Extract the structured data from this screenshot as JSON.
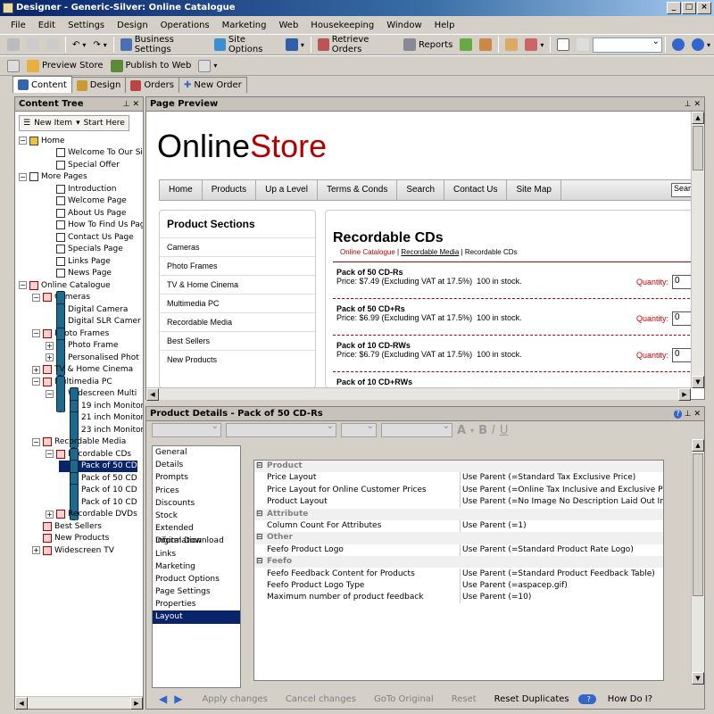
{
  "window": {
    "title": "Designer - Generic-Silver: Online Catalogue"
  },
  "menu": [
    "File",
    "Edit",
    "Settings",
    "Design",
    "Operations",
    "Marketing",
    "Web",
    "Housekeeping",
    "Window",
    "Help"
  ],
  "toolbar1": {
    "business_settings": "Business Settings",
    "site_options": "Site Options",
    "retrieve_orders": "Retrieve Orders",
    "reports": "Reports"
  },
  "toolbar2": {
    "preview_store": "Preview Store",
    "publish_to_web": "Publish to Web"
  },
  "tabs": [
    "Content",
    "Design",
    "Orders",
    "New Order"
  ],
  "content_tree": {
    "title": "Content Tree",
    "new_item": "New Item",
    "start_here": "Start Here",
    "nodes": [
      {
        "label": "Home"
      },
      {
        "label": "Welcome To Our Site"
      },
      {
        "label": "Special Offer"
      },
      {
        "label": "More Pages"
      },
      {
        "label": "Introduction"
      },
      {
        "label": "Welcome Page"
      },
      {
        "label": "About Us Page"
      },
      {
        "label": "How To Find Us Page"
      },
      {
        "label": "Contact Us Page"
      },
      {
        "label": "Specials Page"
      },
      {
        "label": "Links Page"
      },
      {
        "label": "News Page"
      },
      {
        "label": "Online Catalogue"
      },
      {
        "label": "Cameras"
      },
      {
        "label": "Digital Camera"
      },
      {
        "label": "Digital SLR Camer"
      },
      {
        "label": "Photo Frames"
      },
      {
        "label": "Photo Frame"
      },
      {
        "label": "Personalised Phot"
      },
      {
        "label": "TV & Home Cinema"
      },
      {
        "label": "Multimedia PC"
      },
      {
        "label": "Widescreen Multi"
      },
      {
        "label": "19 inch Monitor"
      },
      {
        "label": "21 inch Monitor"
      },
      {
        "label": "23 inch Monitor"
      },
      {
        "label": "Recordable Media"
      },
      {
        "label": "Recordable CDs"
      },
      {
        "label": "Pack of 50 CD"
      },
      {
        "label": "Pack of 50 CD"
      },
      {
        "label": "Pack of 10 CD"
      },
      {
        "label": "Pack of 10 CD"
      },
      {
        "label": "Recordable DVDs"
      },
      {
        "label": "Best Sellers"
      },
      {
        "label": "New Products"
      },
      {
        "label": "Widescreen TV"
      }
    ]
  },
  "preview": {
    "title": "Page Preview",
    "store_name_a": "Online",
    "store_name_b": "Store",
    "nav": [
      "Home",
      "Products",
      "Up a Level",
      "Terms & Conds",
      "Search",
      "Contact Us",
      "Site Map"
    ],
    "search_btn": "Sear",
    "sections_title": "Product Sections",
    "sections": [
      "Cameras",
      "Photo Frames",
      "TV & Home Cinema",
      "Multimedia PC",
      "Recordable Media",
      "Best Sellers",
      "New Products"
    ],
    "heading": "Recordable CDs",
    "breadcrumb": [
      "Online Catalogue",
      "Recordable Media",
      "Recordable CDs"
    ],
    "quantity_label": "Quantity:",
    "products": [
      {
        "name": "Pack of 50 CD-Rs",
        "price": "Price: $7.49 (Excluding VAT at 17.5%)",
        "stock": "100 in stock.",
        "qty": "0"
      },
      {
        "name": "Pack of 50 CD+Rs",
        "price": "Price: $6.99 (Excluding VAT at 17.5%)",
        "stock": "100 in stock.",
        "qty": "0"
      },
      {
        "name": "Pack of 10 CD-RWs",
        "price": "Price: $6.79 (Excluding VAT at 17.5%)",
        "stock": "100 in stock.",
        "qty": "0"
      },
      {
        "name": "Pack of 10 CD+RWs"
      }
    ]
  },
  "details": {
    "title": "Product Details - Pack of 50 CD-Rs",
    "format_labels": {
      "a": "A",
      "b": "B",
      "i": "I",
      "u": "U"
    },
    "sections": [
      "General",
      "Details",
      "Prompts",
      "Prices",
      "Discounts",
      "Stock",
      "Extended Information",
      "Digital Download",
      "Links",
      "Marketing",
      "Product Options",
      "Page Settings",
      "Properties",
      "Layout"
    ],
    "grid": [
      {
        "type": "cat",
        "k": "Product"
      },
      {
        "k": "Price Layout",
        "v": "Use Parent (=Standard Tax Exclusive Price)"
      },
      {
        "k": "Price Layout for Online Customer Prices",
        "v": "Use Parent (=Online Tax Inclusive and Exclusive Price)"
      },
      {
        "k": "Product Layout",
        "v": "Use Parent (=No Image No Description Laid Out In Single"
      },
      {
        "type": "cat",
        "k": "Attribute"
      },
      {
        "k": "Column Count For Attributes",
        "v": "Use Parent (=1)"
      },
      {
        "type": "cat",
        "k": "Other"
      },
      {
        "k": "Feefo Product Logo",
        "v": "Use Parent (=Standard Product Rate Logo)"
      },
      {
        "type": "cat",
        "k": "Feefo"
      },
      {
        "k": "Feefo Feedback Content for Products",
        "v": "Use Parent (=Standard Product Feedback Table)"
      },
      {
        "k": "Feefo Product Logo Type",
        "v": "Use Parent (=aspacep.gif)"
      },
      {
        "k": "Maximum number of product feedback",
        "v": "Use Parent (=10)"
      }
    ],
    "buttons": {
      "apply": "Apply changes",
      "cancel": "Cancel changes",
      "goto": "GoTo Original",
      "reset": "Reset",
      "reset_dup": "Reset Duplicates",
      "howdoi": "How Do I?"
    }
  }
}
